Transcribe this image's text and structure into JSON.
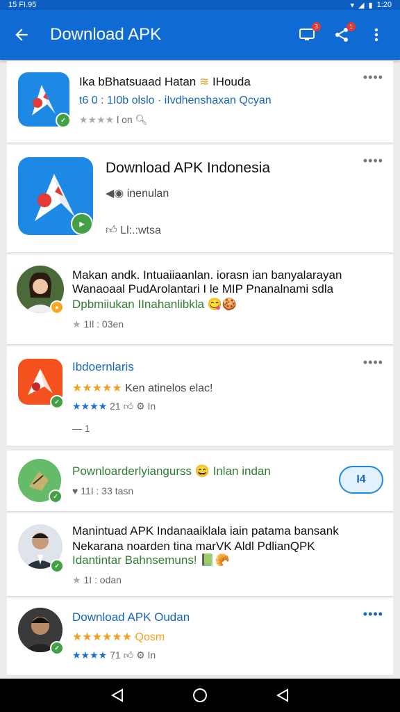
{
  "status": {
    "time": "15 FI.95",
    "battery": "1:20"
  },
  "app_bar": {
    "title": "Download APK",
    "notif_badge": "3",
    "share_badge": "1"
  },
  "cards": [
    {
      "name": "Ika bBhatsuaad Hatan",
      "name_suffix": "IHouda",
      "sub": "t6 0 : 1I0b olslo · iIvdhenshaxan Qcyan",
      "meta": "l on"
    },
    {
      "name": "Download APK Indonesia",
      "sub": "inenulan",
      "meta": "Ll:.:wtsa"
    },
    {
      "line1": "Makan andk. Intuaiiaanlan. iorasn ian banyalarayan",
      "line2": "Wanaoaal PudArolantari I le MIP Pnanalnami sdla",
      "line3": "Dpbmiiukan  IInahanlibkla",
      "meta": "1Il : 03en"
    },
    {
      "name": "Ibdoernlaris",
      "rating_text": "Ken atinelos elac!",
      "meta": "21",
      "meta2": "In",
      "extra": "— 1"
    },
    {
      "name": "Pownloarderlyiangurss",
      "name_suffix": "Inlan indan",
      "meta": "11I : 33 tasn",
      "button": "I4"
    },
    {
      "line1": "Manintuad APK Indanaaiklala iain patama bansank",
      "line2": "Nekarana noarden tina marVK Aldl PdlianQPK",
      "line3": "Idantintar Bahnsemuns!",
      "meta": "1I : odan"
    },
    {
      "name": "Download APK Oudan",
      "rating_text": "Qosm",
      "meta": "71",
      "meta2": "In"
    }
  ],
  "colors": {
    "primary": "#0f6bd3",
    "accent_green": "#2e7d32",
    "star": "#f4a01c",
    "link": "#1565c0"
  }
}
